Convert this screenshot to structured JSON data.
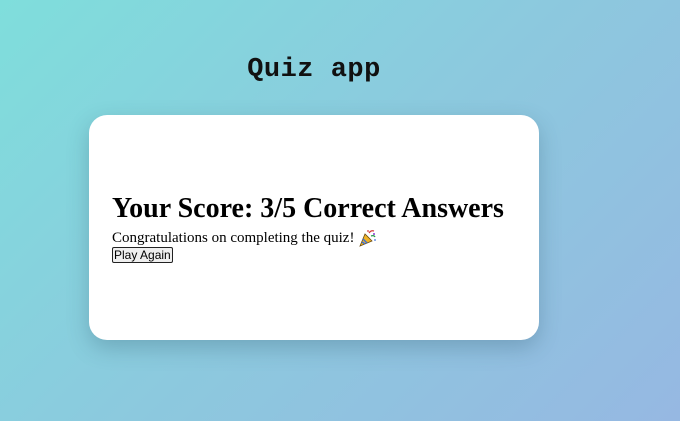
{
  "app": {
    "title": "Quiz app"
  },
  "result": {
    "heading": "Your Score: 3/5 Correct Answers",
    "message": "Congratulations on completing the quiz!",
    "icon": "party-popper-icon",
    "play_again_label": "Play Again"
  },
  "colors": {
    "background_start": "#7fdedc",
    "background_end": "#96b8e2",
    "card": "#ffffff"
  }
}
